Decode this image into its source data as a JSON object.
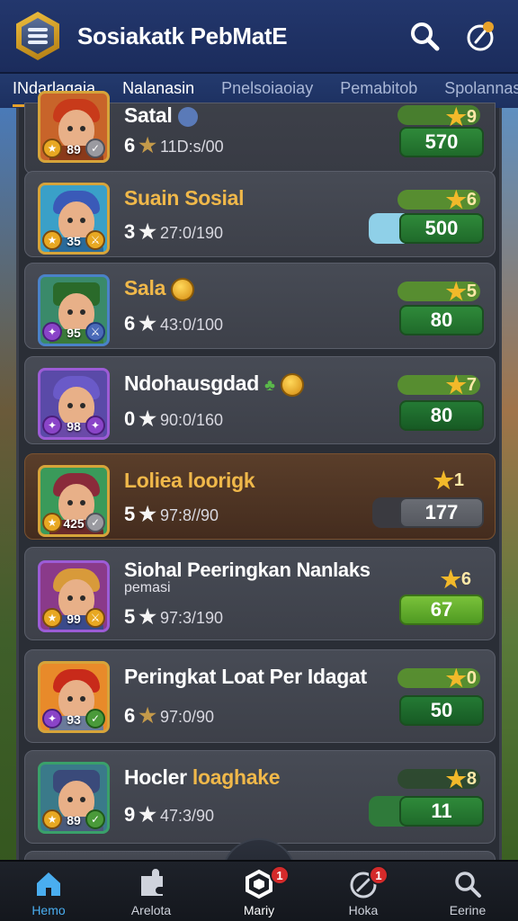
{
  "header": {
    "title": "Sosiakatk PebMatE"
  },
  "tabs": [
    {
      "label": "INdarlagaia"
    },
    {
      "label": "Nalanasin"
    },
    {
      "label": "Pnelsoiaoiay"
    },
    {
      "label": "Pemabitob"
    },
    {
      "label": "Spolannas"
    }
  ],
  "rows": [
    {
      "name": "Satal",
      "level": "89",
      "stars": "6",
      "time": "11D:s/00",
      "rank": "9",
      "score": "570"
    },
    {
      "name": "Suain Sosial",
      "level": "35",
      "stars": "3",
      "time": "27:0/190",
      "rank": "6",
      "score": "500"
    },
    {
      "name": "Sala",
      "level": "95",
      "stars": "6",
      "time": "43:0/100",
      "rank": "5",
      "score": "80"
    },
    {
      "name": "Ndohausgdad",
      "level": "98",
      "stars": "0",
      "time": "90:0/160",
      "rank": "7",
      "score": "80"
    },
    {
      "name": "Loliea loorigk",
      "level": "425",
      "stars": "5",
      "time": "97:8//90",
      "rank": "1",
      "score": "177"
    },
    {
      "name": "Siohal Peeringkan Nanlaks",
      "subname": "pemasi",
      "level": "99",
      "stars": "5",
      "time": "97:3/190",
      "rank": "6",
      "score": "67"
    },
    {
      "name": "Peringkat Loat Per Idagat",
      "level": "93",
      "stars": "6",
      "time": "97:0/90",
      "rank": "0",
      "score": "50"
    },
    {
      "name_part1": "Hocler",
      "name_part2": "loaghake",
      "level": "89",
      "stars": "9",
      "time": "47:3/90",
      "rank": "8",
      "score": "11"
    }
  ],
  "nav": [
    {
      "label": "Hemo",
      "icon": "home-icon"
    },
    {
      "label": "Arelota",
      "icon": "puzzle-icon"
    },
    {
      "label": "Mariy",
      "icon": "hexagon-icon",
      "badge": "1"
    },
    {
      "label": "Hoka",
      "icon": "compass-icon",
      "badge": "1"
    },
    {
      "label": "Eerine",
      "icon": "search-icon"
    }
  ],
  "colors": {
    "header_bg": "#1b2c5c",
    "accent_tab": "#e8a22a",
    "score_green": "#2f8a3a",
    "nav_active": "#4aaef0",
    "star_gold": "#f2b92a"
  }
}
